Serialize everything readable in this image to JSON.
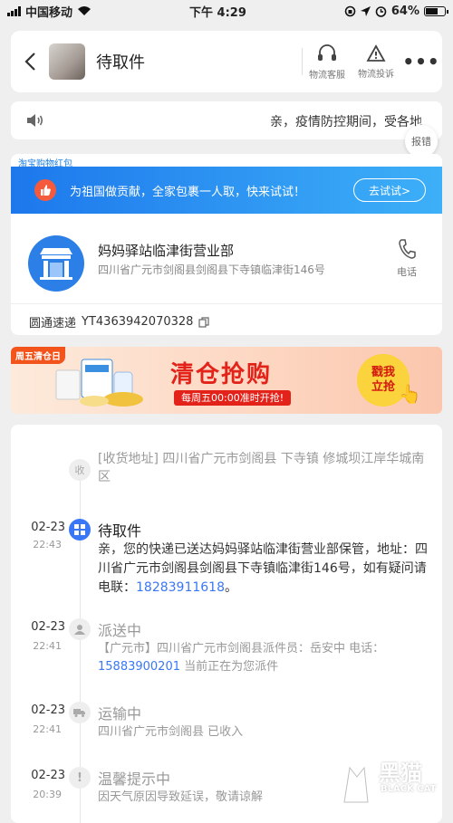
{
  "status_bar": {
    "carrier": "中国移动",
    "time": "下午 4:29",
    "battery": "64%"
  },
  "header": {
    "title": "待取件",
    "service_label": "物流客服",
    "complaint_label": "物流投诉",
    "more": "•••"
  },
  "notice": {
    "text": "亲，疫情防控期间，受各地",
    "report_label": "报错"
  },
  "promo": {
    "tag": "淘宝购物红包",
    "text": "为祖国做贡献，全家包裹一人取，快来试试！",
    "button": "去试试>"
  },
  "station": {
    "name": "妈妈驿站临津街营业部",
    "address": "四川省广元市剑阁县剑阁县下寺镇临津街146号",
    "phone_label": "电话"
  },
  "tracking": {
    "carrier": "圆通速递",
    "number": "YT4363942070328"
  },
  "banner": {
    "badge": "周五清仓日",
    "title": "清仓抢购",
    "subtitle": "每周五00:00准时开抢!",
    "cta": "戳我立抢"
  },
  "timeline": {
    "address": {
      "dot": "收",
      "text": "[收货地址] 四川省广元市剑阁县 下寺镇 修城坝江岸华城南区"
    },
    "events": [
      {
        "date": "02-23",
        "time": "22:43",
        "title": "待取件",
        "desc": "亲，您的快递已送达妈妈驿站临津街营业部保管，地址：四川省广元市剑阁县剑阁县下寺镇临津街146号，如有疑问请电联：",
        "link": "18283911618",
        "suffix": "。"
      },
      {
        "date": "02-23",
        "time": "22:41",
        "title": "派送中",
        "desc": "【广元市】四川省广元市剑阁县派件员：岳安中 电话：",
        "link": "15883900201",
        "suffix": " 当前正在为您派件"
      },
      {
        "date": "02-23",
        "time": "22:41",
        "title": "运输中",
        "desc": "四川省广元市剑阁县 已收入"
      },
      {
        "date": "02-23",
        "time": "20:39",
        "title": "温馨提示中",
        "desc": "因天气原因导致延误，敬请谅解"
      }
    ]
  },
  "watermark": {
    "text": "黑猫",
    "sub": "BLACK CAT"
  },
  "colors": {
    "accent": "#3a77f6",
    "promo_blue": "#1d78ec",
    "banner_red": "#e3231a"
  }
}
